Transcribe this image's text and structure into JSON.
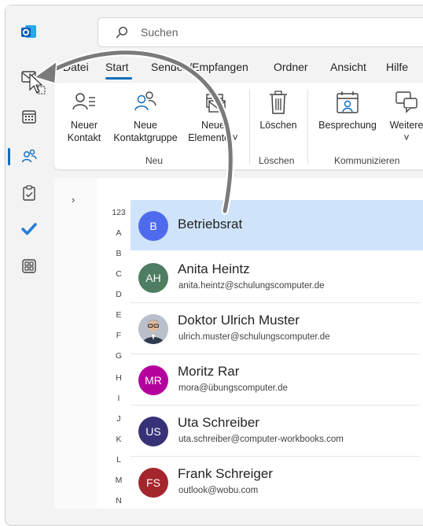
{
  "search": {
    "placeholder": "Suchen"
  },
  "tabs": [
    {
      "label": "Datei"
    },
    {
      "label": "Start"
    },
    {
      "label": "Senden/Empfangen"
    },
    {
      "label": "Ordner"
    },
    {
      "label": "Ansicht"
    },
    {
      "label": "Hilfe"
    }
  ],
  "ribbon": {
    "buttons": [
      {
        "line1": "Neuer",
        "line2": "Kontakt"
      },
      {
        "line1": "Neue",
        "line2": "Kontaktgruppe"
      },
      {
        "line1": "Neue",
        "line2": "Elemente ˅"
      },
      {
        "line1": "Löschen",
        "line2": ""
      },
      {
        "line1": "Besprechung",
        "line2": ""
      },
      {
        "line1": "Weitere",
        "line2": "˅"
      }
    ],
    "groups": [
      {
        "label": "Neu"
      },
      {
        "label": "Löschen"
      },
      {
        "label": "Kommunizieren"
      }
    ]
  },
  "alphabet": [
    "123",
    "A",
    "B",
    "C",
    "D",
    "E",
    "F",
    "G",
    "H",
    "I",
    "J",
    "K",
    "L",
    "M",
    "N"
  ],
  "contacts": [
    {
      "initials": "B",
      "name": "Betriebsrat",
      "email": "",
      "color": "#4f6bed",
      "selected": true
    },
    {
      "initials": "AH",
      "name": "Anita Heintz",
      "email": "anita.heintz@schulungscomputer.de",
      "color": "#498205"
    },
    {
      "initials": "",
      "name": "Doktor Ulrich Muster",
      "email": "ulrich.muster@schulungscomputer.de",
      "color": "#8a8886",
      "photo": true
    },
    {
      "initials": "MR",
      "name": "Moritz Rar",
      "email": "mora@übungscomputer.de",
      "color": "#b4009e"
    },
    {
      "initials": "US",
      "name": "Uta Schreiber",
      "email": "uta.schreiber@computer-workbooks.com",
      "color": "#373277"
    },
    {
      "initials": "FS",
      "name": "Frank Schreiger",
      "email": "outlook@wobu.com",
      "color": "#a4262c"
    }
  ],
  "colors": {
    "accent": "#0f6cbd",
    "selected_row": "#cfe4fa"
  }
}
